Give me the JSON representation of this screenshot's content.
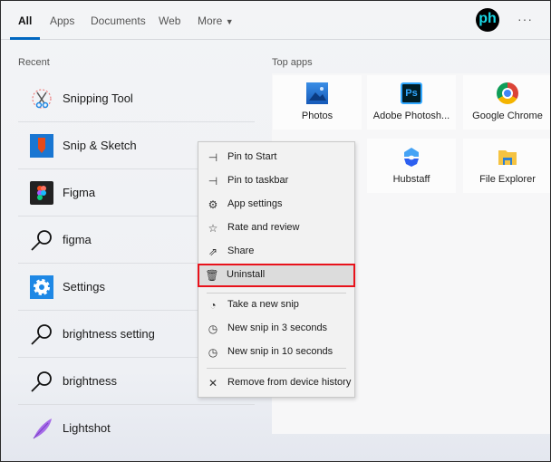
{
  "tabs": [
    {
      "label": "All",
      "active": true
    },
    {
      "label": "Apps"
    },
    {
      "label": "Documents"
    },
    {
      "label": "Web"
    },
    {
      "label": "More"
    }
  ],
  "avatar": "ph",
  "more_options": "···",
  "recent": {
    "title": "Recent",
    "items": [
      {
        "label": "Snipping Tool",
        "icon": "scissors-icon"
      },
      {
        "label": "Snip & Sketch",
        "icon": "snip-sketch-icon"
      },
      {
        "label": "Figma",
        "icon": "figma-icon"
      },
      {
        "label": "figma",
        "icon": "search-icon"
      },
      {
        "label": "Settings",
        "icon": "gear-icon"
      },
      {
        "label": "brightness setting",
        "icon": "search-icon"
      },
      {
        "label": "brightness",
        "icon": "search-icon"
      },
      {
        "label": "Lightshot",
        "icon": "feather-icon"
      }
    ]
  },
  "top_apps": {
    "title": "Top apps",
    "items": [
      {
        "label": "Photos",
        "icon": "photos-icon"
      },
      {
        "label": "Adobe Photosh...",
        "icon": "photoshop-icon",
        "glyph": "Ps"
      },
      {
        "label": "Google Chrome",
        "icon": "chrome-icon"
      },
      {
        "label": "Hubstaff",
        "icon": "hubstaff-icon"
      },
      {
        "label": "File Explorer",
        "icon": "folder-icon"
      }
    ]
  },
  "context_menu": {
    "items": [
      {
        "label": "Pin to Start",
        "icon": "pin-icon",
        "glyph": "⊣"
      },
      {
        "label": "Pin to taskbar",
        "icon": "pin-icon",
        "glyph": "⊣"
      },
      {
        "label": "App settings",
        "icon": "gear-icon",
        "glyph": "⚙"
      },
      {
        "label": "Rate and review",
        "icon": "star-icon",
        "glyph": "☆"
      },
      {
        "label": "Share",
        "icon": "share-icon",
        "glyph": "⇗"
      },
      {
        "label": "Uninstall",
        "icon": "trash-icon",
        "glyph": "🗑",
        "highlighted": true
      },
      {
        "label": "Take a new snip",
        "icon": "snip-icon",
        "glyph": "◔"
      },
      {
        "label": "New snip in 3 seconds",
        "icon": "timer-icon",
        "glyph": "◷"
      },
      {
        "label": "New snip in 10 seconds",
        "icon": "timer-icon",
        "glyph": "◷"
      },
      {
        "label": "Remove from device history",
        "icon": "close-icon",
        "glyph": "✕"
      }
    ]
  },
  "colors": {
    "accent": "#0067c0",
    "highlight_border": "#e8121b"
  }
}
